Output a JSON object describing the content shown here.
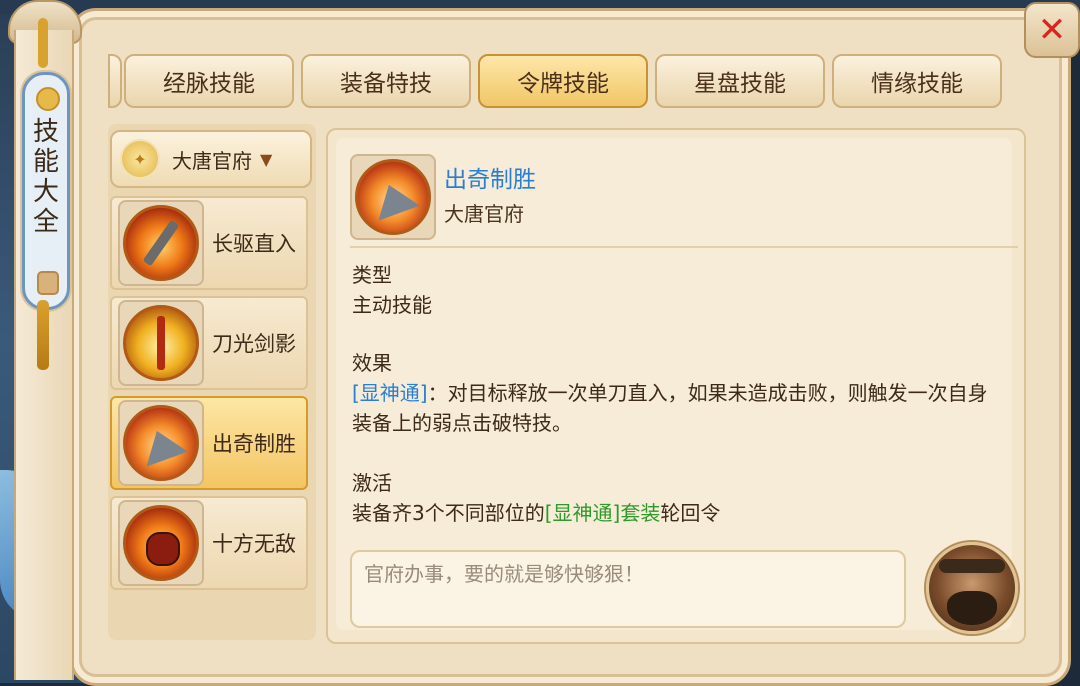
{
  "window": {
    "close_symbol": "✕"
  },
  "sidebar": {
    "title": "技能大全"
  },
  "tabs": [
    {
      "label": "经脉技能",
      "active": false
    },
    {
      "label": "装备特技",
      "active": false
    },
    {
      "label": "令牌技能",
      "active": true
    },
    {
      "label": "星盘技能",
      "active": false
    },
    {
      "label": "情缘技能",
      "active": false
    }
  ],
  "school_selector": {
    "value": "大唐官府",
    "icon": "chevron-down-icon"
  },
  "skills": [
    {
      "name": "长驱直入",
      "icon": "blade-icon",
      "active": false
    },
    {
      "name": "刀光剑影",
      "icon": "sword-icon",
      "active": false
    },
    {
      "name": "出奇制胜",
      "icon": "triangle-blade-icon",
      "active": true
    },
    {
      "name": "十方无敌",
      "icon": "warrior-face-icon",
      "active": false
    }
  ],
  "detail": {
    "name": "出奇制胜",
    "school": "大唐官府",
    "type_label": "类型",
    "type_value": "主动技能",
    "effect_label": "效果",
    "effect_tag": "[显神通]",
    "effect_text": "：对目标释放一次单刀直入，如果未造成击败，则触发一次自身装备上的弱点击破特技。",
    "activate_label": "激活",
    "activate_prefix": "装备齐3个不同部位的",
    "activate_tag": "[显神通]",
    "activate_mid": "套装",
    "activate_suffix": "轮回令",
    "quote": "官府办事，要的就是够快够狠！"
  },
  "colors": {
    "accent_blue": "#2b7fd3",
    "accent_green": "#2f9a2a",
    "close_red": "#d8261e"
  }
}
